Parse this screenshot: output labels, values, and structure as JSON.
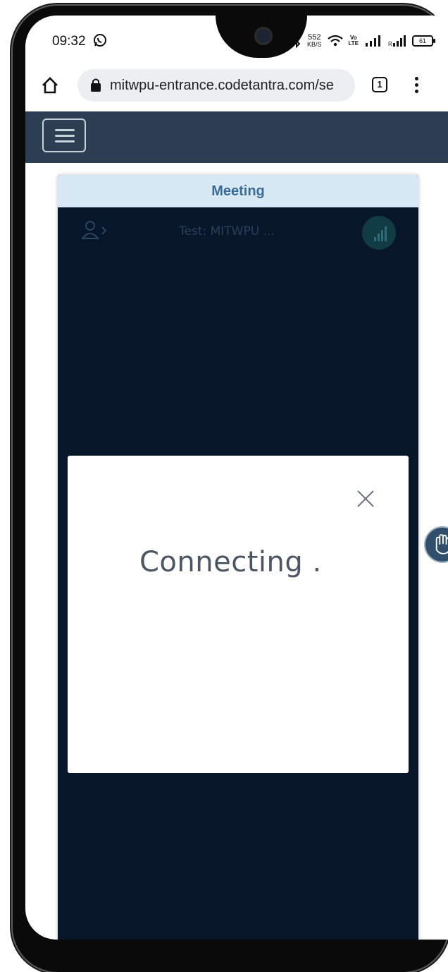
{
  "status_bar": {
    "time": "09:32",
    "speed_value": "552",
    "speed_unit": "KB/S",
    "volte_top": "Vo",
    "volte_bottom": "LTE",
    "battery": "61"
  },
  "browser": {
    "url": "mitwpu-entrance.codetantra.com/se",
    "tab_count": "1"
  },
  "meeting": {
    "header": "Meeting",
    "title": "Test: MITWPU ..."
  },
  "modal": {
    "message": "Connecting ."
  },
  "colors": {
    "navbar": "#2b3e52",
    "meeting_bg": "#081629",
    "header_bg": "#d6e9f5",
    "header_text": "#3a6d95"
  },
  "icons": [
    "home-icon",
    "lock-icon",
    "tabs-icon",
    "more-icon",
    "hamburger-icon",
    "participants-icon",
    "signal-icon",
    "raise-hand-icon",
    "close-icon"
  ]
}
